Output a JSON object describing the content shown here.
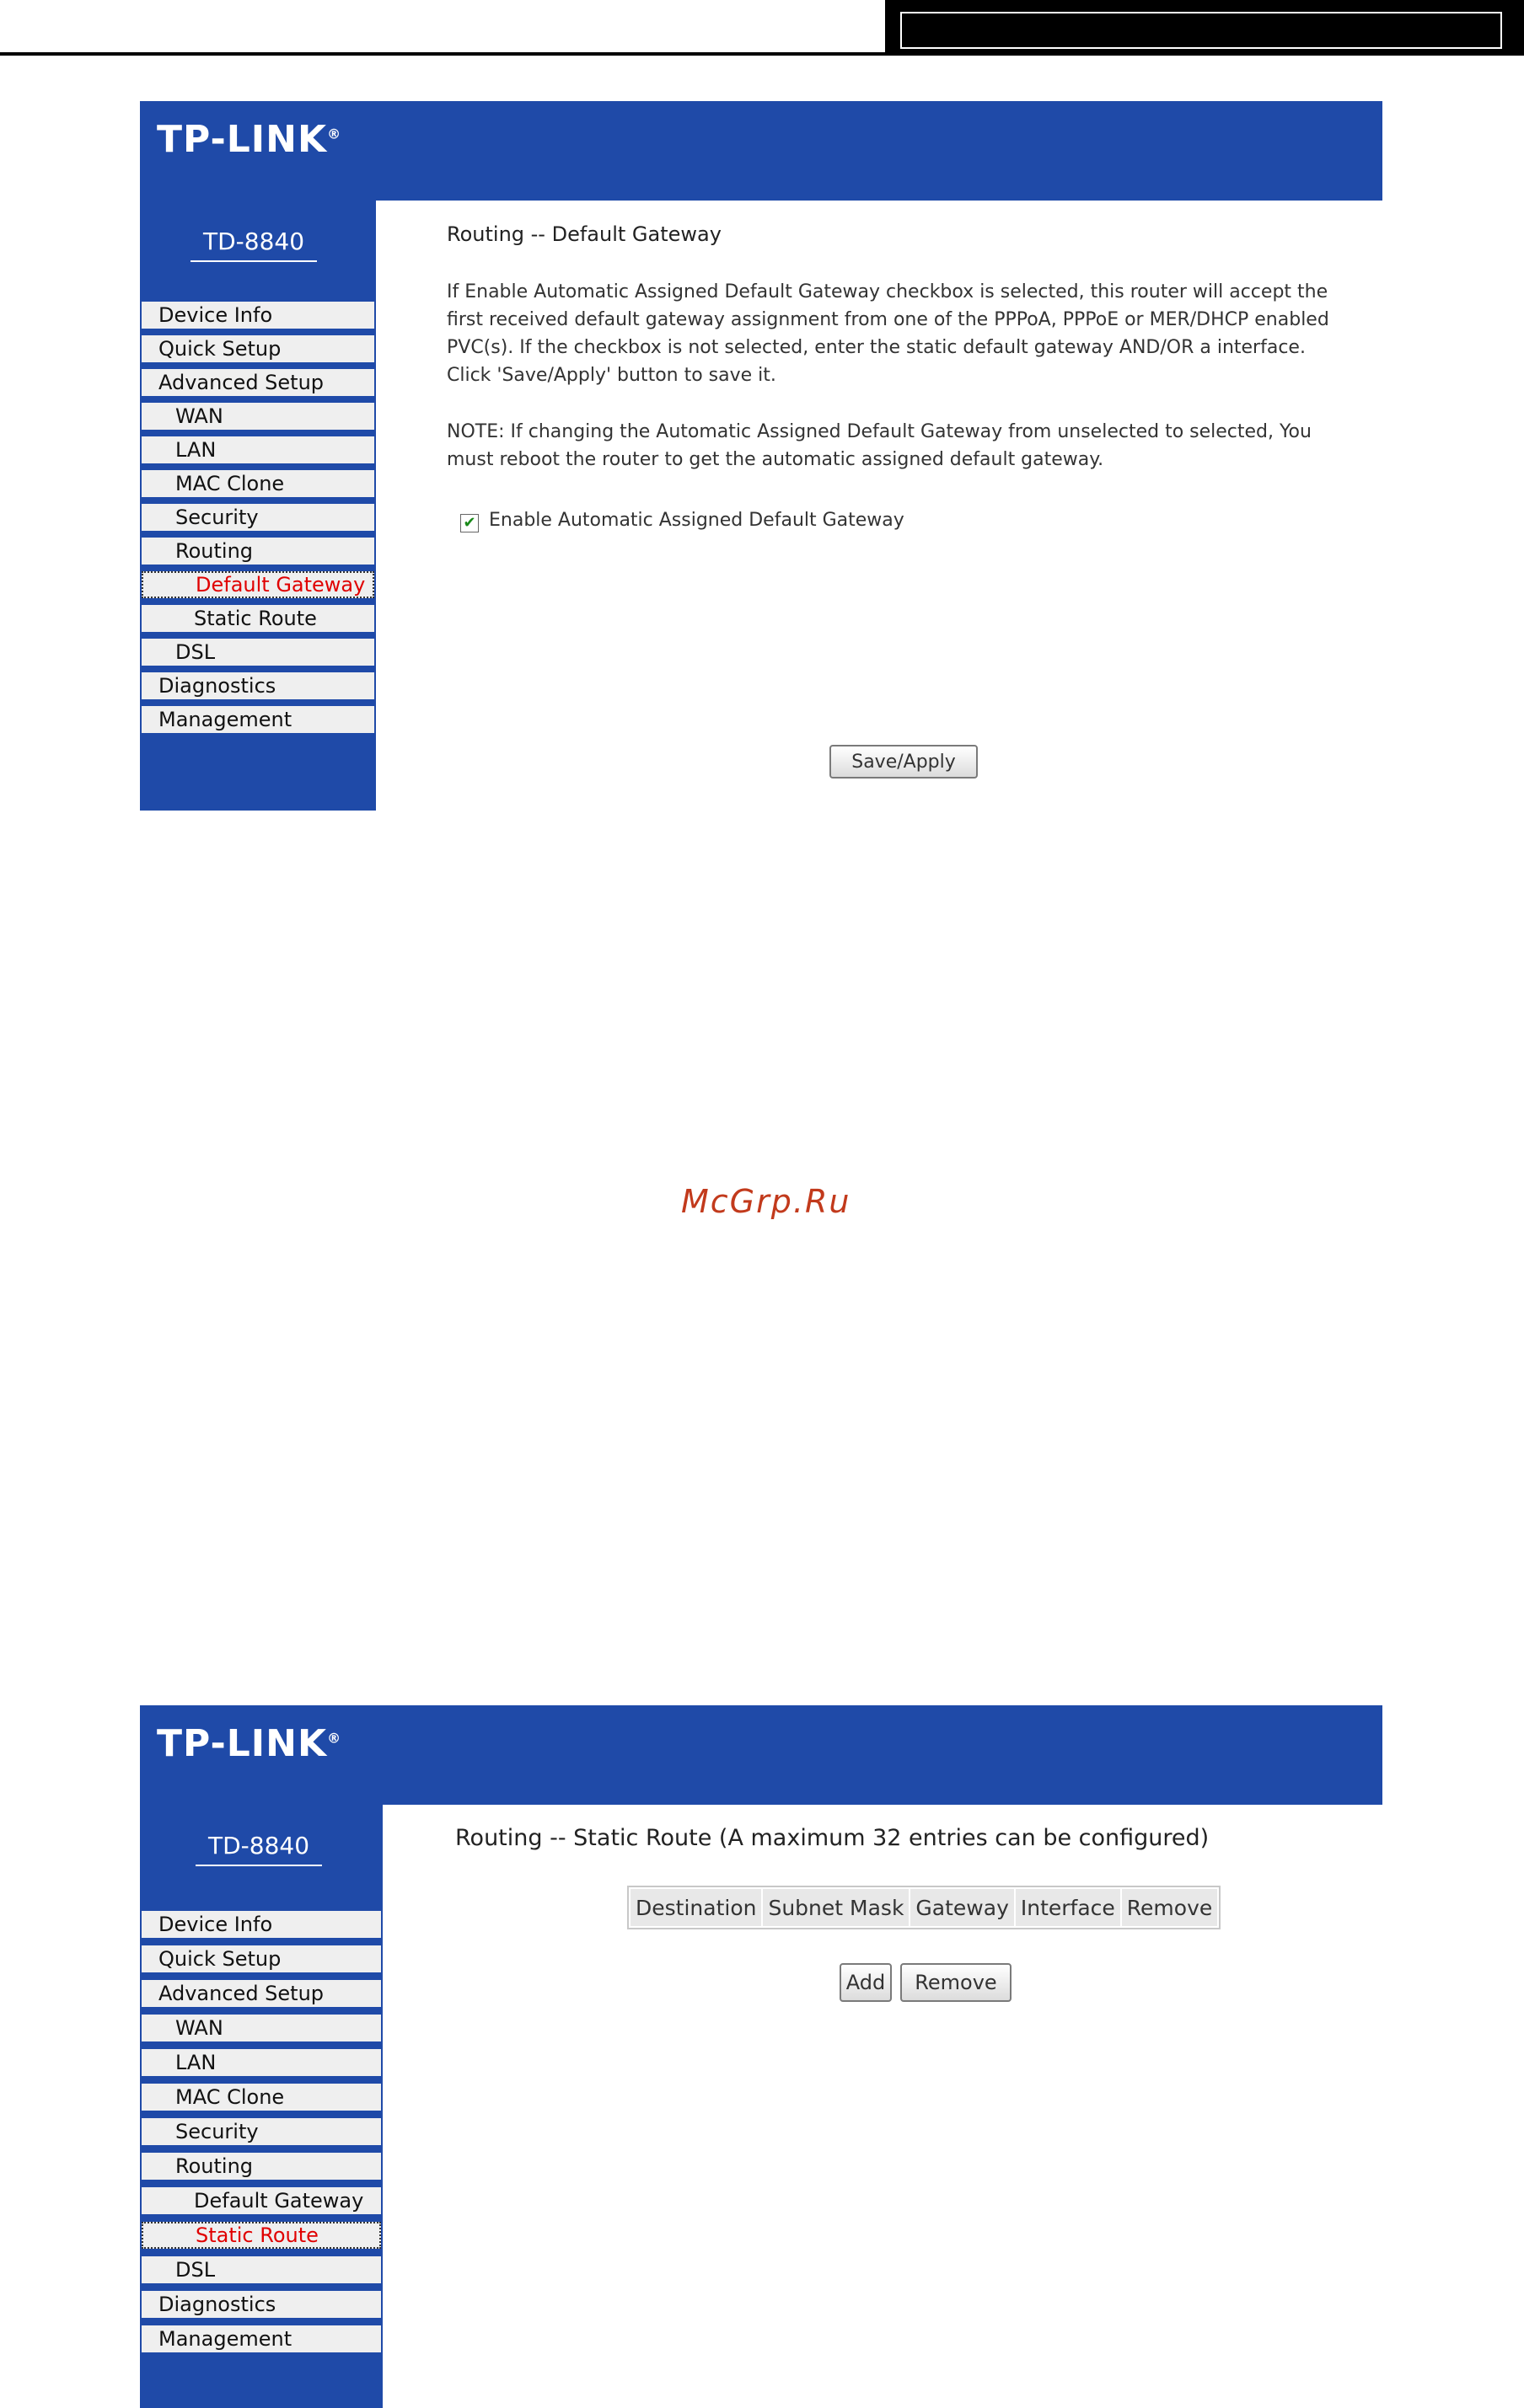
{
  "screens": [
    {
      "brand": "TP-LINK",
      "brand_mark": "®",
      "model": "TD-8840",
      "menu": [
        {
          "label": "Device Info"
        },
        {
          "label": "Quick Setup"
        },
        {
          "label": "Advanced Setup"
        },
        {
          "label": "WAN"
        },
        {
          "label": "LAN"
        },
        {
          "label": "MAC Clone"
        },
        {
          "label": "Security"
        },
        {
          "label": "Routing"
        },
        {
          "label": "Default Gateway"
        },
        {
          "label": "Static Route"
        },
        {
          "label": "DSL"
        },
        {
          "label": "Diagnostics"
        },
        {
          "label": "Management"
        }
      ],
      "title": "Routing -- Default Gateway",
      "description": "If Enable Automatic Assigned Default Gateway checkbox is selected, this router will accept the first received default gateway assignment from one of the PPPoA, PPPoE or MER/DHCP enabled PVC(s). If the checkbox is not selected, enter the static default gateway AND/OR a interface. Click 'Save/Apply' button to save it.",
      "note": "NOTE: If changing the Automatic Assigned Default Gateway from unselected to selected, You must reboot the router to get the automatic assigned default gateway.",
      "checkbox_label": "Enable Automatic Assigned Default Gateway",
      "checkbox_checked": true,
      "save_button": "Save/Apply"
    },
    {
      "brand": "TP-LINK",
      "brand_mark": "®",
      "model": "TD-8840",
      "menu": [
        {
          "label": "Device Info"
        },
        {
          "label": "Quick Setup"
        },
        {
          "label": "Advanced Setup"
        },
        {
          "label": "WAN"
        },
        {
          "label": "LAN"
        },
        {
          "label": "MAC Clone"
        },
        {
          "label": "Security"
        },
        {
          "label": "Routing"
        },
        {
          "label": "Default Gateway"
        },
        {
          "label": "Static Route"
        },
        {
          "label": "DSL"
        },
        {
          "label": "Diagnostics"
        },
        {
          "label": "Management"
        }
      ],
      "title": "Routing -- Static Route (A maximum 32 entries can be configured)",
      "table_headers": [
        "Destination",
        "Subnet Mask",
        "Gateway",
        "Interface",
        "Remove"
      ],
      "add_button": "Add",
      "remove_button": "Remove"
    }
  ],
  "watermark": "McGrp.Ru",
  "colors": {
    "header_blue": "#1f4aa8",
    "active_red": "#e00000",
    "watermark": "#c23a1c"
  }
}
